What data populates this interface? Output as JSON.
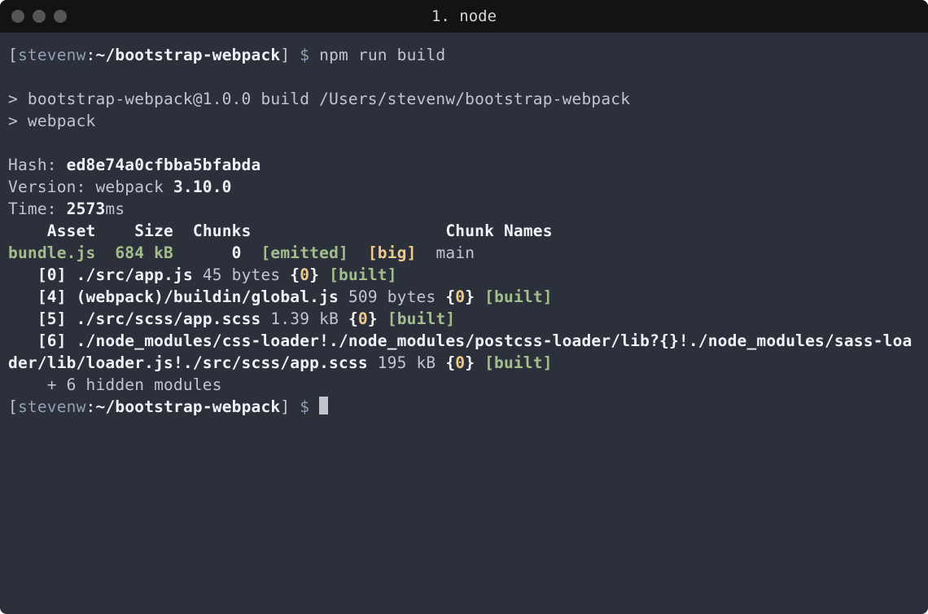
{
  "window": {
    "title": "1. node"
  },
  "prompt1": {
    "open_bracket": "[",
    "user": "stevenw",
    "colon": ":",
    "path": "~/bootstrap-webpack",
    "close_bracket": "]",
    "symbol": " $ ",
    "command": "npm run build"
  },
  "script_echo": {
    "line1": "> bootstrap-webpack@1.0.0 build /Users/stevenw/bootstrap-webpack",
    "line2": "> webpack"
  },
  "hash": {
    "label": "Hash: ",
    "value": "ed8e74a0cfbba5bfabda"
  },
  "version": {
    "label": "Version: webpack ",
    "value": "3.10.0"
  },
  "time": {
    "label": "Time: ",
    "value": "2573",
    "unit": "ms"
  },
  "table_header": {
    "asset": "Asset",
    "size": "Size",
    "chunks": "Chunks",
    "chunk_names": "Chunk Names"
  },
  "bundle": {
    "file": "bundle.js",
    "size": "684 kB",
    "chunk_id": "0",
    "emitted": "[emitted]",
    "big": "[big]",
    "name": "main"
  },
  "modules": [
    {
      "id": "[0]",
      "path": "./src/app.js",
      "size": " 45 bytes ",
      "chunk_open": "{",
      "chunk": "0",
      "chunk_close": "} ",
      "built": "[built]"
    },
    {
      "id": "[4]",
      "path": "(webpack)/buildin/global.js",
      "size": " 509 bytes ",
      "chunk_open": "{",
      "chunk": "0",
      "chunk_close": "} ",
      "built": "[built]"
    },
    {
      "id": "[5]",
      "path": "./src/scss/app.scss",
      "size": " 1.39 kB ",
      "chunk_open": "{",
      "chunk": "0",
      "chunk_close": "} ",
      "built": "[built]"
    },
    {
      "id": "[6]",
      "path": "./node_modules/css-loader!./node_modules/postcss-loader/lib?{}!./node_modules/sass-loader/lib/loader.js!./src/scss/app.scss",
      "size": " 195 kB ",
      "chunk_open": "{",
      "chunk": "0",
      "chunk_close": "} ",
      "built": "[built]"
    }
  ],
  "hidden": "    + 6 hidden modules",
  "prompt2": {
    "open_bracket": "[",
    "user": "stevenw",
    "colon": ":",
    "path": "~/bootstrap-webpack",
    "close_bracket": "]",
    "symbol": " $ "
  }
}
